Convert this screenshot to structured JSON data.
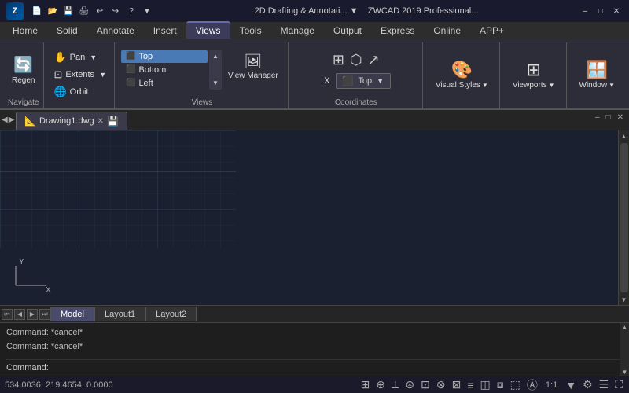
{
  "titlebar": {
    "app_name": "ZWCAD 2019 Professional...",
    "workspace": "2D Drafting & Annotati...",
    "min_label": "–",
    "max_label": "□",
    "close_label": "✕"
  },
  "ribbon": {
    "tabs": [
      {
        "label": "Home"
      },
      {
        "label": "Solid"
      },
      {
        "label": "Annotate"
      },
      {
        "label": "Insert"
      },
      {
        "label": "Views"
      },
      {
        "label": "Tools"
      },
      {
        "label": "Manage"
      },
      {
        "label": "Output"
      },
      {
        "label": "Express"
      },
      {
        "label": "Online"
      },
      {
        "label": "APP+"
      }
    ],
    "active_tab": "Views",
    "navigate": {
      "label": "Navigate",
      "pan": "Pan",
      "extents": "Extents",
      "orbit": "Orbit",
      "regen": "Regen"
    },
    "views": {
      "label": "Views",
      "items": [
        "Top",
        "Bottom",
        "Left"
      ],
      "selected": "Top",
      "view_manager": "View Manager"
    },
    "coordinates": {
      "label": "Coordinates",
      "current": "Top",
      "x_label": "X"
    },
    "visual_styles": {
      "label": "Visual Styles"
    },
    "viewports": {
      "label": "Viewports"
    },
    "window": {
      "label": "Window"
    }
  },
  "document": {
    "tab_name": "Drawing1.dwg",
    "inner_min": "–",
    "inner_max": "□",
    "inner_close": "✕"
  },
  "layout_tabs": {
    "tabs": [
      "Model",
      "Layout1",
      "Layout2"
    ]
  },
  "command": {
    "history": [
      "Command: *cancel*",
      "Command: *cancel*"
    ],
    "prompt": "Command:"
  },
  "statusbar": {
    "coords": "534.0036, 219.4654, 0.0000",
    "scale": "1:1"
  }
}
